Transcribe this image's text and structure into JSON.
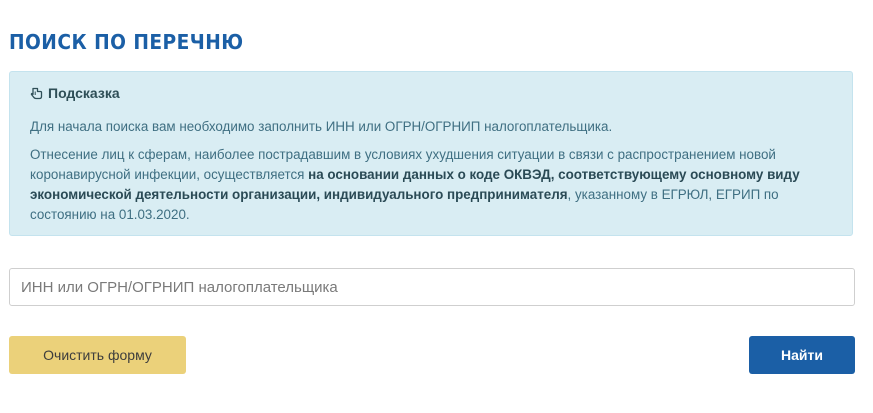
{
  "page": {
    "title": "ПОИСК ПО ПЕРЕЧНЮ"
  },
  "hint": {
    "icon": "thumb-pointer-icon",
    "title": "Подсказка",
    "paragraph1": "Для начала поиска вам необходимо заполнить ИНН или ОГРН/ОГРНИП налогоплательщика.",
    "paragraph2_start": "Отнесение лиц к сферам, наиболее пострадавшим в условиях ухудшения ситуации в связи с распространением новой коронавирусной инфекции, осуществляется ",
    "paragraph2_bold": "на основании данных о коде ОКВЭД, соответствующему основному виду экономической деятельности организации, индивидуального предпринимателя",
    "paragraph2_end": ", указанному в ЕГРЮЛ, ЕГРИП по состоянию на 01.03.2020."
  },
  "search": {
    "value": "",
    "placeholder": "ИНН или ОГРН/ОГРНИП налогоплательщика"
  },
  "buttons": {
    "clear_label": "Очистить форму",
    "find_label": "Найти"
  },
  "colors": {
    "title": "#1b5fa6",
    "hint_background": "#d9edf3",
    "clear_button": "#ebd17a",
    "find_button": "#1b5fa6"
  }
}
